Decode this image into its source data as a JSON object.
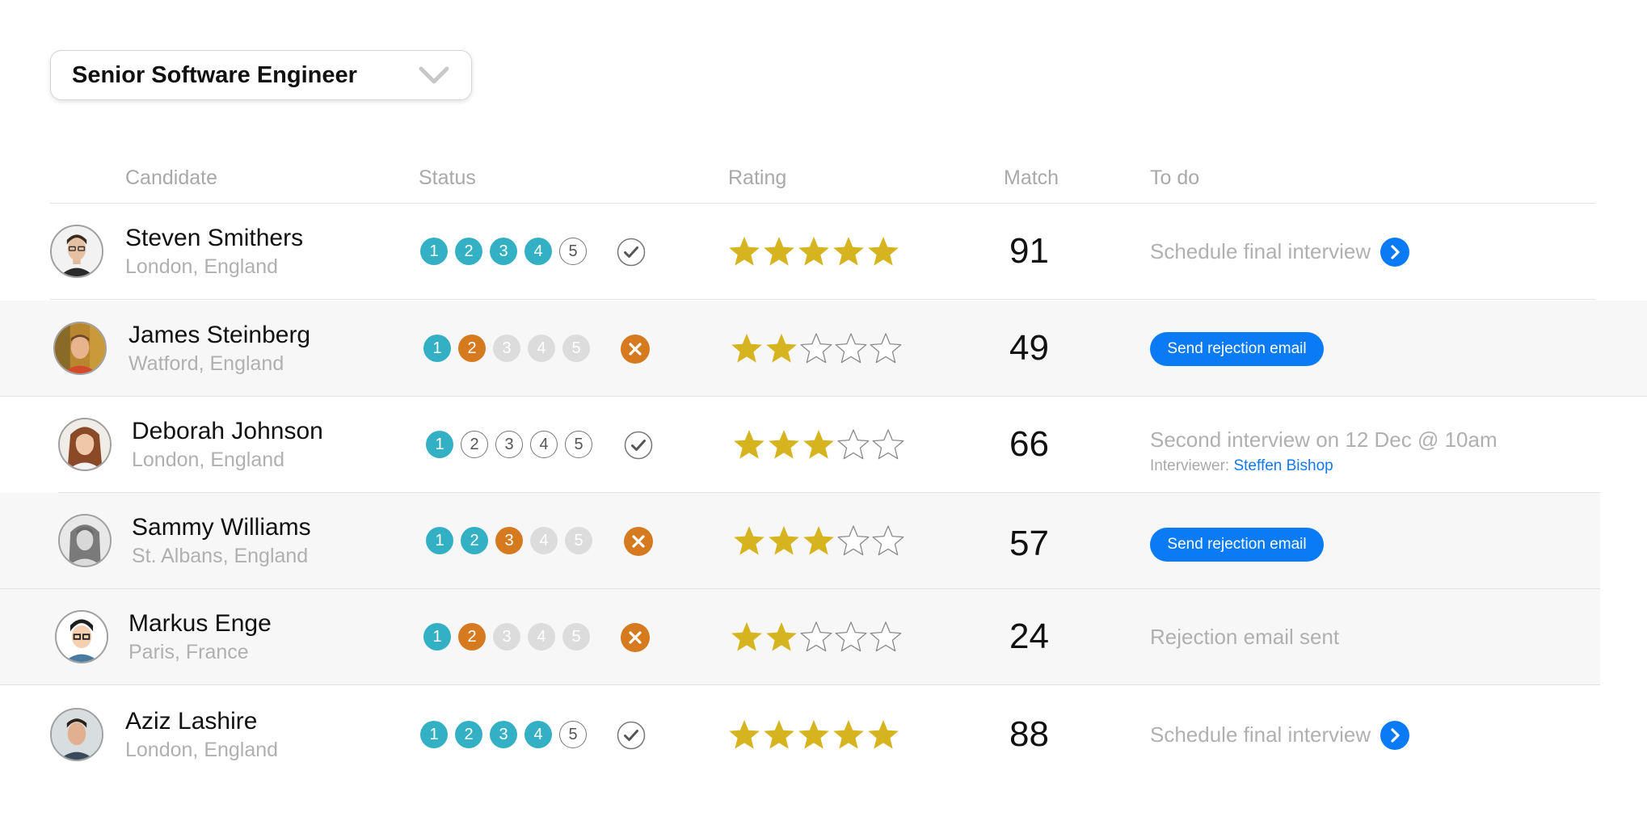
{
  "job_select": {
    "value": "Senior Software Engineer",
    "icon": "chevron-down-icon"
  },
  "columns": {
    "candidate": "Candidate",
    "status": "Status",
    "rating": "Rating",
    "match": "Match",
    "todo": "To do"
  },
  "colors": {
    "step_done": "#33b0c3",
    "step_failed": "#d67a20",
    "step_skipped": "#dcdcdc",
    "star": "#d6b420",
    "action_blue": "#0a7bf5"
  },
  "candidates": [
    {
      "name": "Steven Smithers",
      "location": "London, England",
      "steps": [
        {
          "label": "1",
          "state": "done"
        },
        {
          "label": "2",
          "state": "done"
        },
        {
          "label": "3",
          "state": "done"
        },
        {
          "label": "4",
          "state": "done"
        },
        {
          "label": "5",
          "state": "todo"
        }
      ],
      "result": "check",
      "rating": 5,
      "match": "91",
      "todo": {
        "type": "action",
        "text": "Schedule final interview"
      }
    },
    {
      "name": "James Steinberg",
      "location": "Watford, England",
      "steps": [
        {
          "label": "1",
          "state": "done"
        },
        {
          "label": "2",
          "state": "fail"
        },
        {
          "label": "3",
          "state": "skip"
        },
        {
          "label": "4",
          "state": "skip"
        },
        {
          "label": "5",
          "state": "skip"
        }
      ],
      "result": "reject",
      "rating": 2,
      "match": "49",
      "todo": {
        "type": "button",
        "text": "Send rejection email"
      }
    },
    {
      "name": "Deborah Johnson",
      "location": "London, England",
      "steps": [
        {
          "label": "1",
          "state": "done"
        },
        {
          "label": "2",
          "state": "todo"
        },
        {
          "label": "3",
          "state": "todo"
        },
        {
          "label": "4",
          "state": "todo"
        },
        {
          "label": "5",
          "state": "todo"
        }
      ],
      "result": "check",
      "rating": 3,
      "match": "66",
      "todo": {
        "type": "info",
        "text": "Second interview on 12 Dec @ 10am",
        "sub_label": "Interviewer:",
        "sub_link": "Steffen Bishop"
      }
    },
    {
      "name": "Sammy Williams",
      "location": "St. Albans, England",
      "steps": [
        {
          "label": "1",
          "state": "done"
        },
        {
          "label": "2",
          "state": "done"
        },
        {
          "label": "3",
          "state": "fail"
        },
        {
          "label": "4",
          "state": "skip"
        },
        {
          "label": "5",
          "state": "skip"
        }
      ],
      "result": "reject",
      "rating": 3,
      "match": "57",
      "todo": {
        "type": "button",
        "text": "Send rejection email"
      }
    },
    {
      "name": "Markus Enge",
      "location": "Paris, France",
      "steps": [
        {
          "label": "1",
          "state": "done"
        },
        {
          "label": "2",
          "state": "fail"
        },
        {
          "label": "3",
          "state": "skip"
        },
        {
          "label": "4",
          "state": "skip"
        },
        {
          "label": "5",
          "state": "skip"
        }
      ],
      "result": "reject",
      "rating": 2,
      "match": "24",
      "todo": {
        "type": "text",
        "text": "Rejection email sent"
      }
    },
    {
      "name": "Aziz Lashire",
      "location": "London, England",
      "steps": [
        {
          "label": "1",
          "state": "done"
        },
        {
          "label": "2",
          "state": "done"
        },
        {
          "label": "3",
          "state": "done"
        },
        {
          "label": "4",
          "state": "done"
        },
        {
          "label": "5",
          "state": "todo"
        }
      ],
      "result": "check",
      "rating": 5,
      "match": "88",
      "todo": {
        "type": "action",
        "text": "Schedule final interview"
      }
    }
  ]
}
